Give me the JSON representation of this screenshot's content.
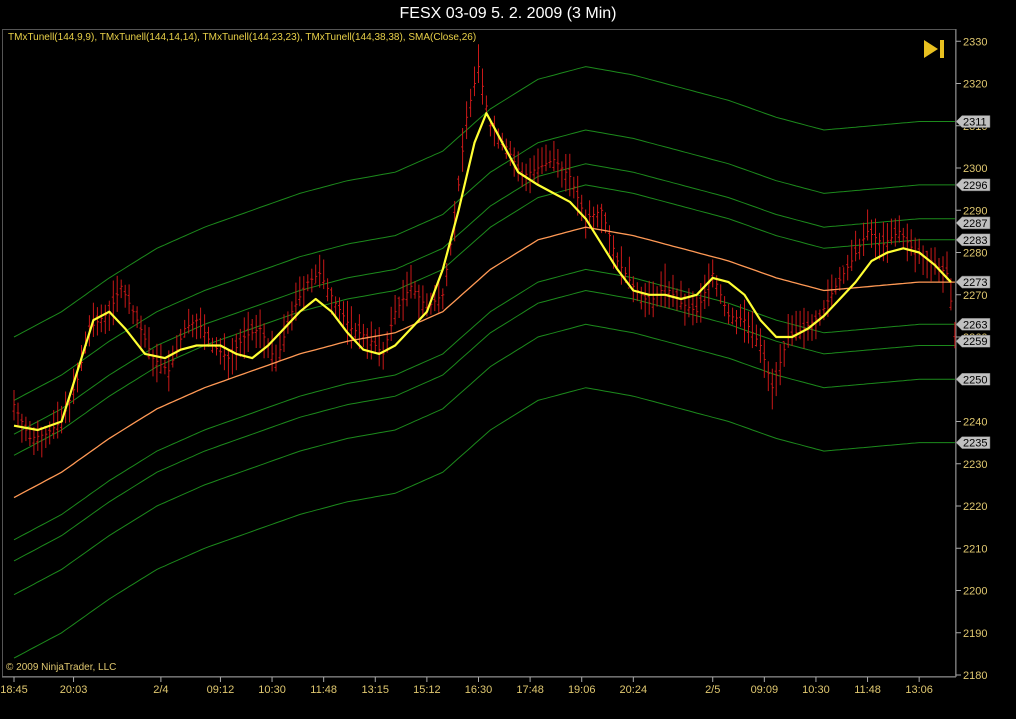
{
  "window": {
    "title": "FESX 03-09  5. 2. 2009 (3 Min)"
  },
  "legend_text": "TMxTunell(144,9,9), TMxTunell(144,14,14), TMxTunell(144,23,23), TMxTunell(144,38,38), SMA(Close,26)",
  "copyright": "© 2009 NinjaTrader, LLC",
  "icons": {
    "end": "skip-to-end-icon"
  },
  "colors": {
    "candles": "#c81818",
    "sma": "#ffff33",
    "mid_line": "#ff9955",
    "bands": "#1c8a1c",
    "badge_bg": "#c0c0c0",
    "background": "#000000"
  },
  "chart_data": {
    "type": "line",
    "title": "FESX 03-09  5. 2. 2009 (3 Min)",
    "ylim": [
      2180,
      2332
    ],
    "y_ticks": [
      2180,
      2190,
      2200,
      2210,
      2220,
      2230,
      2240,
      2250,
      2260,
      2270,
      2280,
      2290,
      2300,
      2310,
      2320,
      2330
    ],
    "x_ticks": [
      {
        "i": 0,
        "label": "18:45"
      },
      {
        "i": 15,
        "label": "20:03"
      },
      {
        "i": 37,
        "label": "2/4"
      },
      {
        "i": 52,
        "label": "09:12"
      },
      {
        "i": 65,
        "label": "10:30"
      },
      {
        "i": 78,
        "label": "11:48"
      },
      {
        "i": 91,
        "label": "13:15"
      },
      {
        "i": 104,
        "label": "15:12"
      },
      {
        "i": 117,
        "label": "16:30"
      },
      {
        "i": 130,
        "label": "17:48"
      },
      {
        "i": 143,
        "label": "19:06"
      },
      {
        "i": 156,
        "label": "20:24"
      },
      {
        "i": 176,
        "label": "2/5"
      },
      {
        "i": 189,
        "label": "09:09"
      },
      {
        "i": 202,
        "label": "10:30"
      },
      {
        "i": 215,
        "label": "11:48"
      },
      {
        "i": 228,
        "label": "13:06"
      }
    ],
    "price_badges": [
      2311,
      2296,
      2287,
      2283,
      2273,
      2263,
      2259,
      2250,
      2235
    ],
    "series": [
      {
        "role": "price",
        "values": [
          [
            0,
            2244
          ],
          [
            4,
            2236
          ],
          [
            8,
            2237
          ],
          [
            12,
            2240
          ],
          [
            16,
            2250
          ],
          [
            19,
            2262
          ],
          [
            24,
            2266
          ],
          [
            27,
            2272
          ],
          [
            31,
            2264
          ],
          [
            35,
            2255
          ],
          [
            39,
            2252
          ],
          [
            43,
            2262
          ],
          [
            46,
            2264
          ],
          [
            50,
            2258
          ],
          [
            54,
            2255
          ],
          [
            58,
            2260
          ],
          [
            62,
            2262
          ],
          [
            66,
            2254
          ],
          [
            70,
            2266
          ],
          [
            74,
            2273
          ],
          [
            77,
            2275
          ],
          [
            81,
            2268
          ],
          [
            85,
            2262
          ],
          [
            89,
            2260
          ],
          [
            93,
            2256
          ],
          [
            96,
            2266
          ],
          [
            100,
            2272
          ],
          [
            104,
            2267
          ],
          [
            108,
            2270
          ],
          [
            111,
            2288
          ],
          [
            114,
            2312
          ],
          [
            117,
            2324
          ],
          [
            120,
            2310
          ],
          [
            124,
            2305
          ],
          [
            128,
            2298
          ],
          [
            132,
            2300
          ],
          [
            136,
            2302
          ],
          [
            140,
            2298
          ],
          [
            144,
            2288
          ],
          [
            148,
            2290
          ],
          [
            152,
            2278
          ],
          [
            156,
            2272
          ],
          [
            160,
            2268
          ],
          [
            164,
            2272
          ],
          [
            168,
            2268
          ],
          [
            172,
            2266
          ],
          [
            176,
            2275
          ],
          [
            180,
            2265
          ],
          [
            184,
            2264
          ],
          [
            188,
            2258
          ],
          [
            191,
            2248
          ],
          [
            195,
            2260
          ],
          [
            199,
            2262
          ],
          [
            203,
            2265
          ],
          [
            207,
            2272
          ],
          [
            211,
            2278
          ],
          [
            215,
            2285
          ],
          [
            219,
            2282
          ],
          [
            223,
            2285
          ],
          [
            227,
            2280
          ],
          [
            231,
            2278
          ],
          [
            235,
            2275
          ],
          [
            237,
            2262
          ]
        ]
      },
      {
        "role": "sma",
        "name": "SMA(Close,26)",
        "values": [
          [
            0,
            2239
          ],
          [
            6,
            2238
          ],
          [
            12,
            2240
          ],
          [
            16,
            2252
          ],
          [
            20,
            2264
          ],
          [
            24,
            2266
          ],
          [
            28,
            2262
          ],
          [
            33,
            2256
          ],
          [
            38,
            2255
          ],
          [
            42,
            2257
          ],
          [
            46,
            2258
          ],
          [
            52,
            2258
          ],
          [
            56,
            2256
          ],
          [
            60,
            2255
          ],
          [
            64,
            2258
          ],
          [
            68,
            2262
          ],
          [
            72,
            2266
          ],
          [
            76,
            2269
          ],
          [
            80,
            2266
          ],
          [
            84,
            2261
          ],
          [
            88,
            2257
          ],
          [
            92,
            2256
          ],
          [
            96,
            2258
          ],
          [
            100,
            2262
          ],
          [
            104,
            2266
          ],
          [
            108,
            2276
          ],
          [
            112,
            2290
          ],
          [
            116,
            2306
          ],
          [
            119,
            2313
          ],
          [
            123,
            2306
          ],
          [
            127,
            2299
          ],
          [
            132,
            2296
          ],
          [
            136,
            2294
          ],
          [
            140,
            2292
          ],
          [
            144,
            2288
          ],
          [
            148,
            2282
          ],
          [
            152,
            2276
          ],
          [
            156,
            2271
          ],
          [
            160,
            2270
          ],
          [
            164,
            2270
          ],
          [
            168,
            2269
          ],
          [
            172,
            2270
          ],
          [
            176,
            2274
          ],
          [
            180,
            2273
          ],
          [
            184,
            2270
          ],
          [
            188,
            2264
          ],
          [
            192,
            2260
          ],
          [
            196,
            2260
          ],
          [
            200,
            2262
          ],
          [
            204,
            2265
          ],
          [
            208,
            2269
          ],
          [
            212,
            2273
          ],
          [
            216,
            2278
          ],
          [
            220,
            2280
          ],
          [
            224,
            2281
          ],
          [
            228,
            2280
          ],
          [
            232,
            2277
          ],
          [
            236,
            2273
          ]
        ]
      },
      {
        "role": "mid",
        "values": [
          [
            0,
            2222
          ],
          [
            12,
            2228
          ],
          [
            24,
            2236
          ],
          [
            36,
            2243
          ],
          [
            48,
            2248
          ],
          [
            60,
            2252
          ],
          [
            72,
            2256
          ],
          [
            84,
            2259
          ],
          [
            96,
            2261
          ],
          [
            108,
            2266
          ],
          [
            120,
            2276
          ],
          [
            132,
            2283
          ],
          [
            144,
            2286
          ],
          [
            156,
            2284
          ],
          [
            168,
            2281
          ],
          [
            180,
            2278
          ],
          [
            192,
            2274
          ],
          [
            204,
            2271
          ],
          [
            216,
            2272
          ],
          [
            228,
            2273
          ],
          [
            237,
            2273
          ]
        ]
      },
      {
        "role": "band",
        "offset": 10
      },
      {
        "role": "band",
        "offset": -10
      },
      {
        "role": "band",
        "offset": 15
      },
      {
        "role": "band",
        "offset": -15
      },
      {
        "role": "band",
        "offset": 23
      },
      {
        "role": "band",
        "offset": -23
      },
      {
        "role": "band",
        "offset": 38
      },
      {
        "role": "band",
        "offset": -38
      }
    ]
  }
}
